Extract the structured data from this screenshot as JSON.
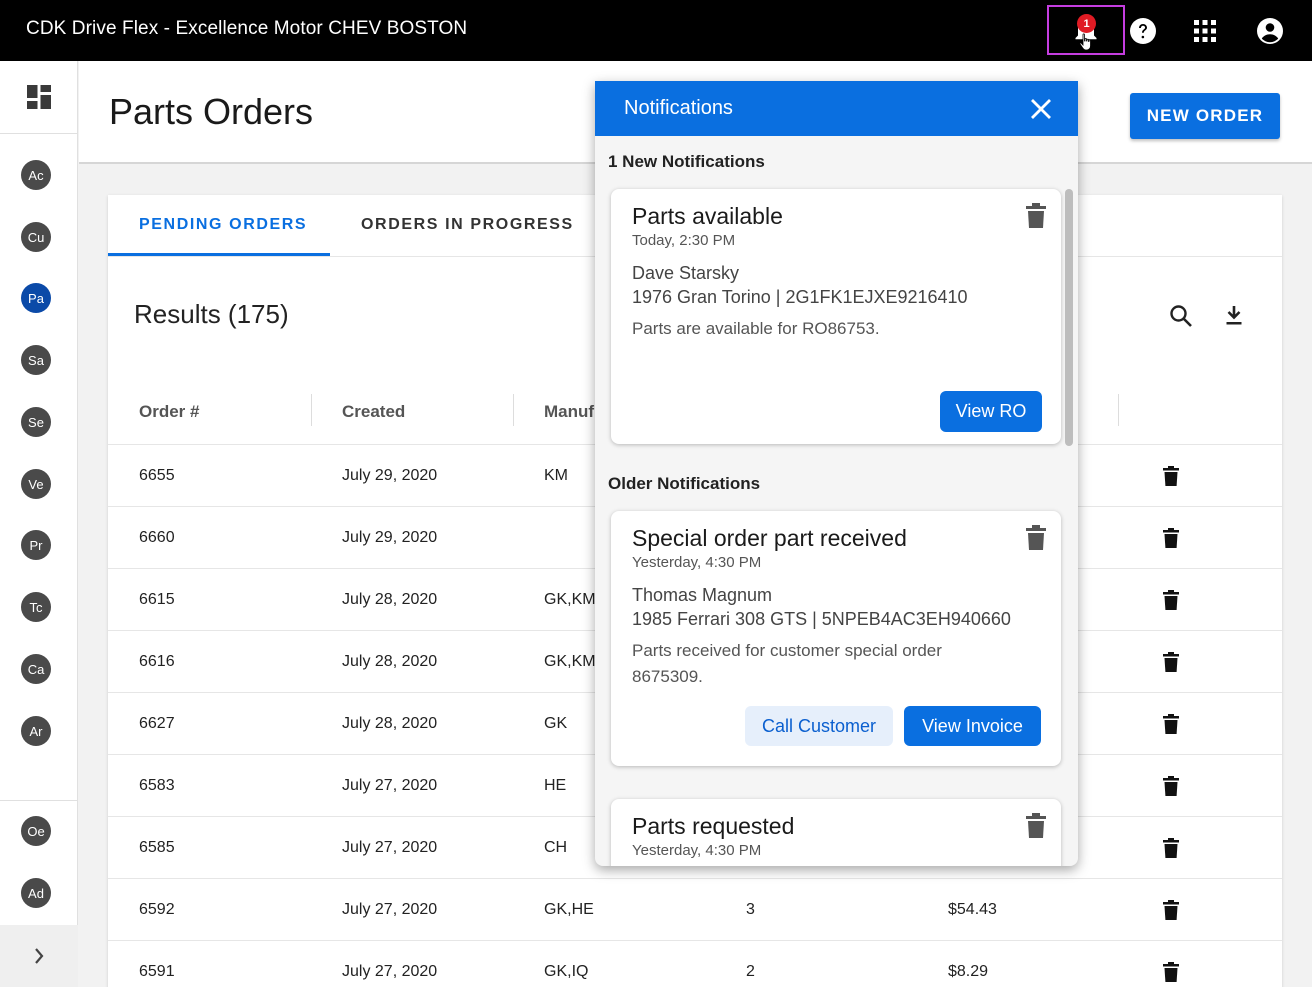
{
  "topbar": {
    "title": "CDK Drive Flex - Excellence Motor CHEV BOSTON",
    "notification_count": "1",
    "icons": [
      "bell-icon",
      "help-icon",
      "apps-grid-icon",
      "account-icon"
    ]
  },
  "sidebar": {
    "items": [
      {
        "label": "Ac"
      },
      {
        "label": "Cu"
      },
      {
        "label": "Pa",
        "active": true
      },
      {
        "label": "Sa"
      },
      {
        "label": "Se"
      },
      {
        "label": "Ve"
      },
      {
        "label": "Pr"
      },
      {
        "label": "Tc"
      },
      {
        "label": "Ca"
      },
      {
        "label": "Ar"
      }
    ],
    "bottom_items": [
      {
        "label": "Oe"
      },
      {
        "label": "Ad"
      }
    ]
  },
  "header": {
    "title": "Parts Orders",
    "new_order_label": "NEW ORDER"
  },
  "tabs": [
    {
      "label": "PENDING ORDERS",
      "active": true
    },
    {
      "label": "ORDERS IN PROGRESS",
      "active": false
    }
  ],
  "results_label": "Results (175)",
  "table": {
    "columns": [
      "Order #",
      "Created",
      "Manuf"
    ],
    "rows": [
      {
        "order": "6655",
        "created": "July 29, 2020",
        "manuf": "KM",
        "qty": "",
        "total": ""
      },
      {
        "order": "6660",
        "created": "July 29, 2020",
        "manuf": "",
        "qty": "",
        "total": ""
      },
      {
        "order": "6615",
        "created": "July 28, 2020",
        "manuf": "GK,KM",
        "qty": "",
        "total": ""
      },
      {
        "order": "6616",
        "created": "July 28, 2020",
        "manuf": "GK,KM",
        "qty": "",
        "total": ""
      },
      {
        "order": "6627",
        "created": "July 28, 2020",
        "manuf": "GK",
        "qty": "",
        "total": ""
      },
      {
        "order": "6583",
        "created": "July 27, 2020",
        "manuf": "HE",
        "qty": "",
        "total": ""
      },
      {
        "order": "6585",
        "created": "July 27, 2020",
        "manuf": "CH",
        "qty": "",
        "total": ""
      },
      {
        "order": "6592",
        "created": "July 27, 2020",
        "manuf": "GK,HE",
        "qty": "3",
        "total": "$54.43"
      },
      {
        "order": "6591",
        "created": "July 27, 2020",
        "manuf": "GK,IQ",
        "qty": "2",
        "total": "$8.29"
      }
    ]
  },
  "notifications": {
    "title": "Notifications",
    "new_label": "1 New Notifications",
    "older_label": "Older Notifications",
    "new_items": [
      {
        "title": "Parts available",
        "time": "Today, 2:30 PM",
        "name": "Dave Starsky",
        "vehicle": "1976 Gran Torino | 2G1FK1EJXE9216410",
        "message": "Parts are available for RO86753.",
        "primary_action": "View RO"
      }
    ],
    "older_items": [
      {
        "title": "Special order part received",
        "time": "Yesterday, 4:30 PM",
        "name": "Thomas Magnum",
        "vehicle": "1985 Ferrari 308 GTS | 5NPEB4AC3EH940660",
        "message": "Parts received for customer special order 8675309.",
        "secondary_action": "Call Customer",
        "primary_action": "View Invoice"
      },
      {
        "title": "Parts requested",
        "time": "Yesterday, 4:30 PM"
      }
    ]
  },
  "colors": {
    "accent": "#0a6fe0",
    "topbar": "#000000",
    "badge": "#e01b24",
    "highlight_box": "#c53de0"
  }
}
